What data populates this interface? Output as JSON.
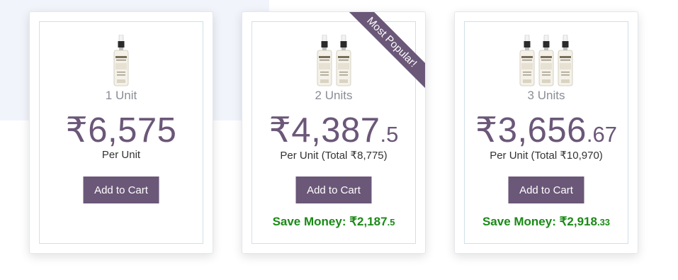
{
  "ribbon": {
    "label": "Most Popular!"
  },
  "cards": [
    {
      "unit_label": "1 Unit",
      "bottle_count": 1,
      "price_main": "₹6,575",
      "price_decimal": "",
      "per_unit": "Per Unit",
      "button_label": "Add to Cart",
      "save_label": "",
      "save_decimal": ""
    },
    {
      "unit_label": "2 Units",
      "bottle_count": 2,
      "price_main": "₹4,387",
      "price_decimal": ".5",
      "per_unit": "Per Unit (Total ₹8,775)",
      "button_label": "Add to Cart",
      "save_label": "Save Money: ₹2,187",
      "save_decimal": ".5"
    },
    {
      "unit_label": "3 Units",
      "bottle_count": 3,
      "price_main": "₹3,656",
      "price_decimal": ".67",
      "per_unit": "Per Unit (Total ₹10,970)",
      "button_label": "Add to Cart",
      "save_label": "Save Money: ₹2,918",
      "save_decimal": ".33"
    }
  ],
  "colors": {
    "brand": "#6b5778",
    "save_green": "#1a8a16",
    "muted": "#8a8d96"
  }
}
